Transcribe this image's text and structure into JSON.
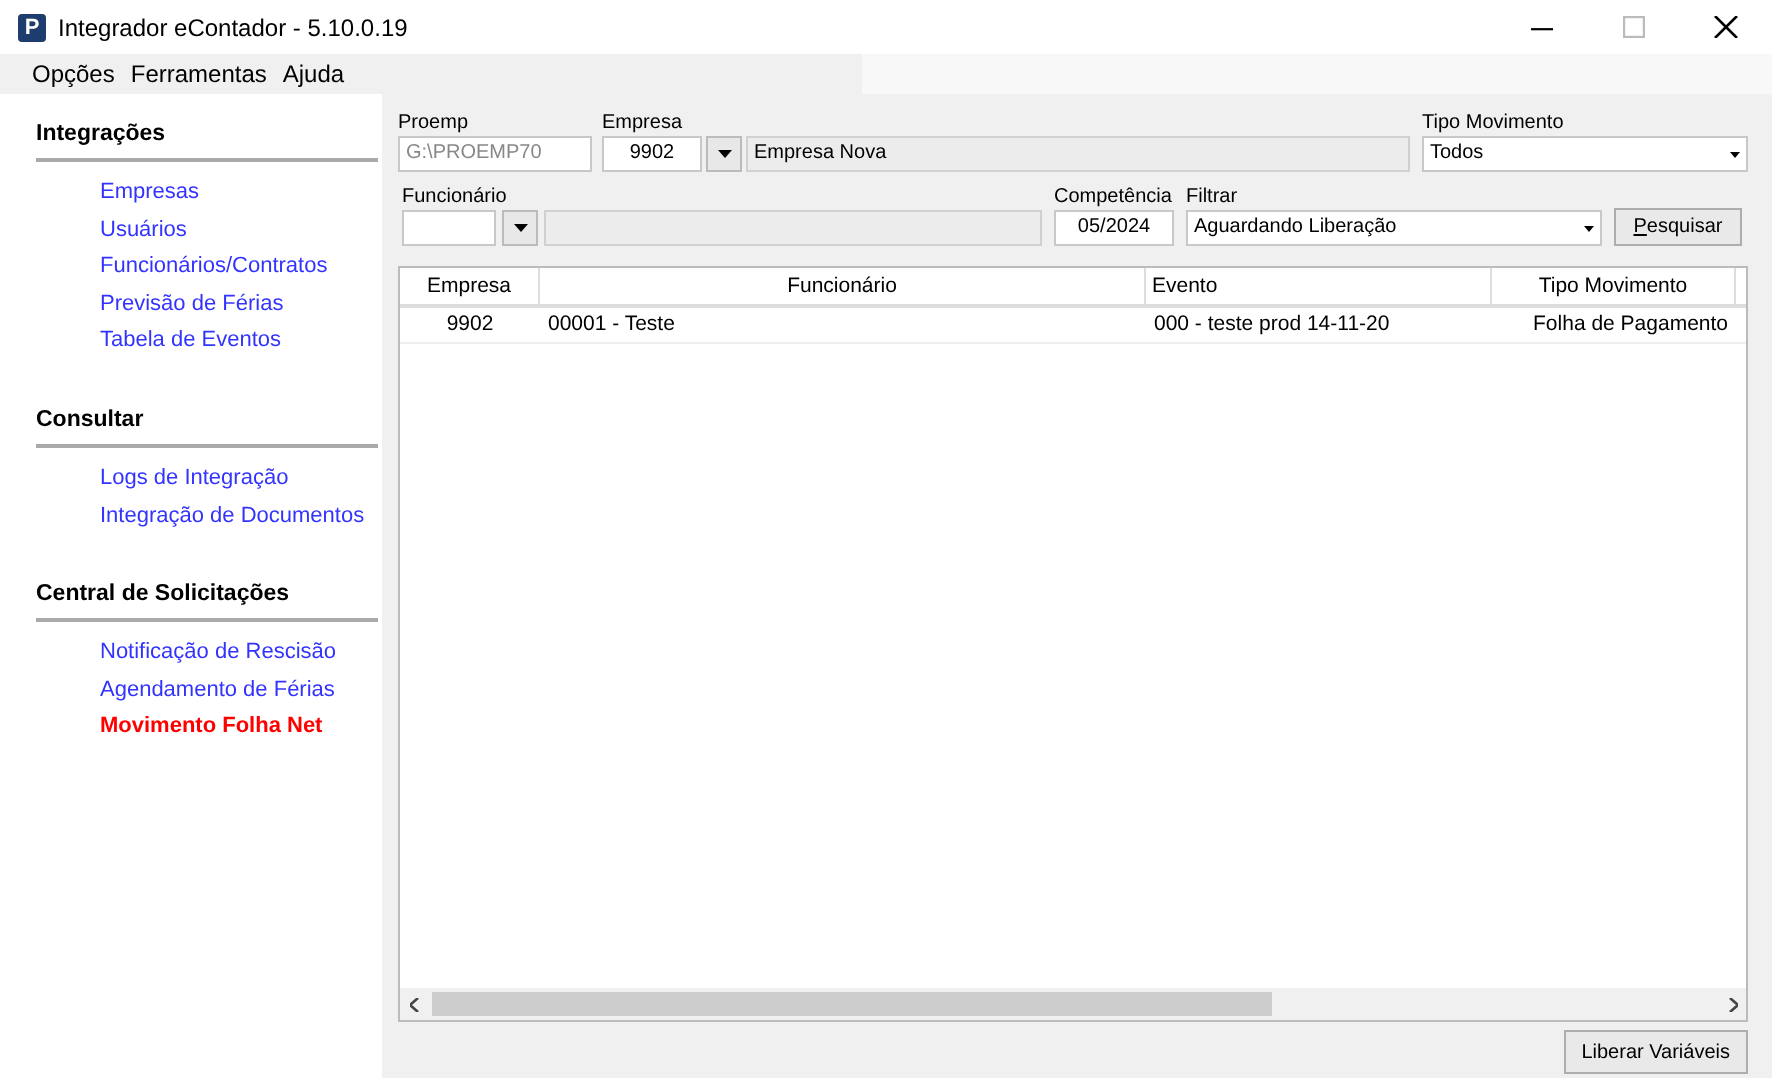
{
  "window": {
    "icon_letter": "P",
    "title": "Integrador eContador - 5.10.0.19"
  },
  "menu": [
    "Opções",
    "Ferramentas",
    "Ajuda"
  ],
  "sidebar": [
    {
      "title": "Integrações",
      "items": [
        {
          "label": "Empresas",
          "selected": false
        },
        {
          "label": "Usuários",
          "selected": false
        },
        {
          "label": "Funcionários/Contratos",
          "selected": false
        },
        {
          "label": "Previsão de Férias",
          "selected": false
        },
        {
          "label": "Tabela de Eventos",
          "selected": false
        }
      ]
    },
    {
      "title": "Consultar",
      "items": [
        {
          "label": "Logs de Integração",
          "selected": false
        },
        {
          "label": "Integração de Documentos",
          "selected": false
        }
      ]
    },
    {
      "title": "Central de Solicitações",
      "items": [
        {
          "label": "Notificação de Rescisão",
          "selected": false
        },
        {
          "label": "Agendamento de Férias",
          "selected": false
        },
        {
          "label": "Movimento Folha Net",
          "selected": true
        }
      ]
    }
  ],
  "filters": {
    "proemp": {
      "label": "Proemp",
      "value": "G:\\PROEMP70",
      "disabled": true
    },
    "empresa": {
      "label": "Empresa",
      "code": "9902",
      "name": "Empresa Nova"
    },
    "tipo_movimento": {
      "label": "Tipo Movimento",
      "value": "Todos"
    },
    "funcionario": {
      "label": "Funcionário"
    },
    "competencia": {
      "label": "Competência",
      "value": "05/2024"
    },
    "filtrar": {
      "label": "Filtrar",
      "value": "Aguardando Liberação"
    },
    "search_button": "Pesquisar"
  },
  "table": {
    "columns": [
      "Empresa",
      "Funcionário",
      "Evento",
      "Tipo Movimento"
    ],
    "rows": [
      [
        "9902",
        "00001 - Teste",
        "000 - teste prod 14-11-20",
        "Folha de Pagamento"
      ]
    ]
  },
  "footer_button": "Liberar Variáveis"
}
